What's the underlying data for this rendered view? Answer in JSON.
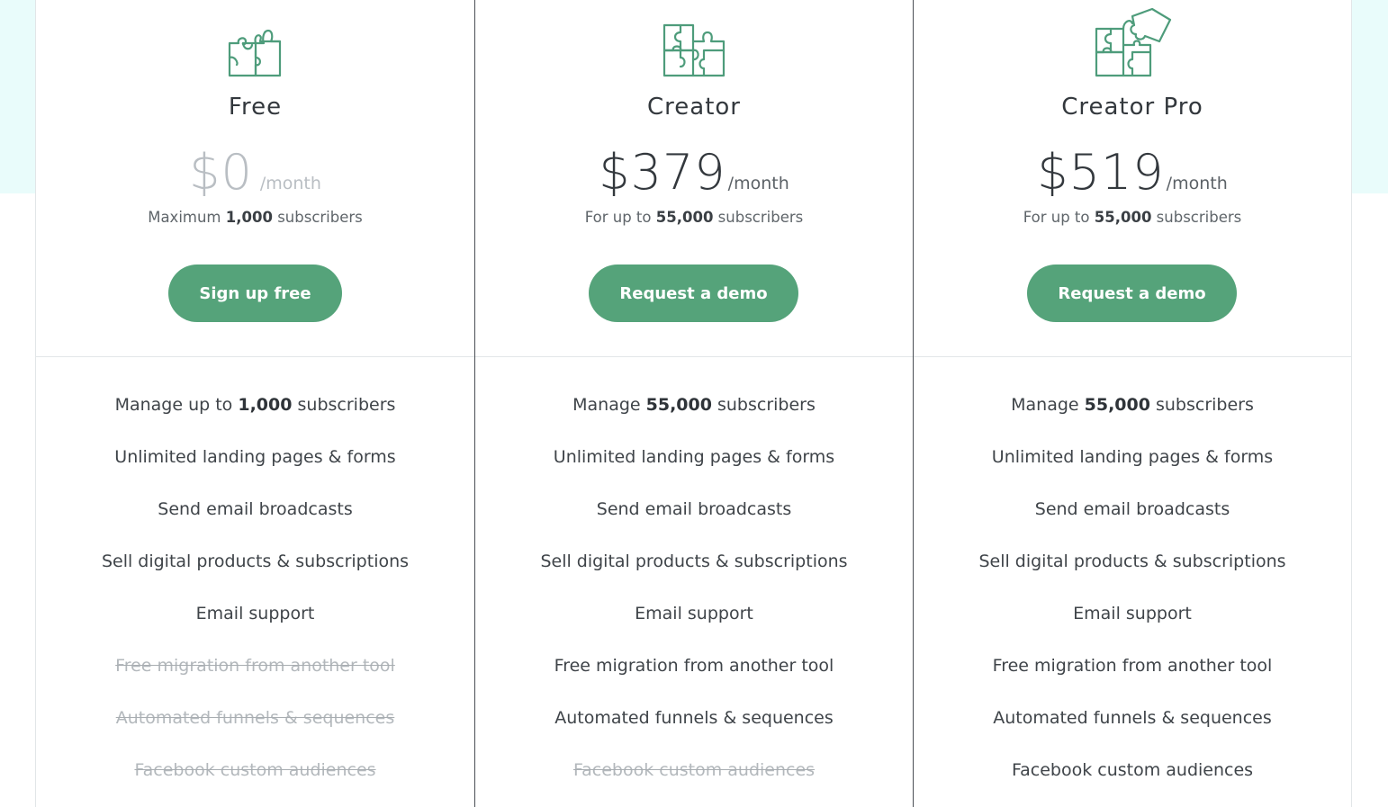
{
  "theme": {
    "accent": "#55a37a",
    "icon_stroke": "#4e9c7b",
    "band": "#e9fcfb"
  },
  "plans": [
    {
      "name": "Free",
      "icon": "puzzle-two-pieces-icon",
      "price": "$0",
      "period": "/month",
      "price_muted": true,
      "limit_prefix": "Maximum ",
      "limit_value": "1,000",
      "limit_suffix": " subscribers",
      "cta_label": "Sign up free",
      "features": [
        {
          "pre": "Manage up to ",
          "bold": "1,000",
          "post": " subscribers",
          "included": true
        },
        {
          "pre": "Unlimited landing pages & forms",
          "bold": "",
          "post": "",
          "included": true
        },
        {
          "pre": "Send email broadcasts",
          "bold": "",
          "post": "",
          "included": true
        },
        {
          "pre": "Sell digital products & subscriptions",
          "bold": "",
          "post": "",
          "included": true
        },
        {
          "pre": "Email support",
          "bold": "",
          "post": "",
          "included": true
        },
        {
          "pre": "Free migration from another tool",
          "bold": "",
          "post": "",
          "included": false
        },
        {
          "pre": "Automated funnels & sequences",
          "bold": "",
          "post": "",
          "included": false
        },
        {
          "pre": "Facebook custom audiences",
          "bold": "",
          "post": "",
          "included": false
        }
      ]
    },
    {
      "name": "Creator",
      "icon": "puzzle-four-pieces-icon",
      "price": "$379",
      "period": "/month",
      "price_muted": false,
      "limit_prefix": "For up to ",
      "limit_value": "55,000",
      "limit_suffix": " subscribers",
      "cta_label": "Request a demo",
      "features": [
        {
          "pre": "Manage ",
          "bold": "55,000",
          "post": " subscribers",
          "included": true
        },
        {
          "pre": "Unlimited landing pages & forms",
          "bold": "",
          "post": "",
          "included": true
        },
        {
          "pre": "Send email broadcasts",
          "bold": "",
          "post": "",
          "included": true
        },
        {
          "pre": "Sell digital products & subscriptions",
          "bold": "",
          "post": "",
          "included": true
        },
        {
          "pre": "Email support",
          "bold": "",
          "post": "",
          "included": true
        },
        {
          "pre": "Free migration from another tool",
          "bold": "",
          "post": "",
          "included": true
        },
        {
          "pre": "Automated funnels & sequences",
          "bold": "",
          "post": "",
          "included": true
        },
        {
          "pre": "Facebook custom audiences",
          "bold": "",
          "post": "",
          "included": false
        }
      ]
    },
    {
      "name": "Creator Pro",
      "icon": "puzzle-five-pieces-icon",
      "price": "$519",
      "period": "/month",
      "price_muted": false,
      "limit_prefix": "For up to ",
      "limit_value": "55,000",
      "limit_suffix": " subscribers",
      "cta_label": "Request a demo",
      "features": [
        {
          "pre": "Manage ",
          "bold": "55,000",
          "post": " subscribers",
          "included": true
        },
        {
          "pre": "Unlimited landing pages & forms",
          "bold": "",
          "post": "",
          "included": true
        },
        {
          "pre": "Send email broadcasts",
          "bold": "",
          "post": "",
          "included": true
        },
        {
          "pre": "Sell digital products & subscriptions",
          "bold": "",
          "post": "",
          "included": true
        },
        {
          "pre": "Email support",
          "bold": "",
          "post": "",
          "included": true
        },
        {
          "pre": "Free migration from another tool",
          "bold": "",
          "post": "",
          "included": true
        },
        {
          "pre": "Automated funnels & sequences",
          "bold": "",
          "post": "",
          "included": true
        },
        {
          "pre": "Facebook custom audiences",
          "bold": "",
          "post": "",
          "included": true
        }
      ]
    }
  ]
}
